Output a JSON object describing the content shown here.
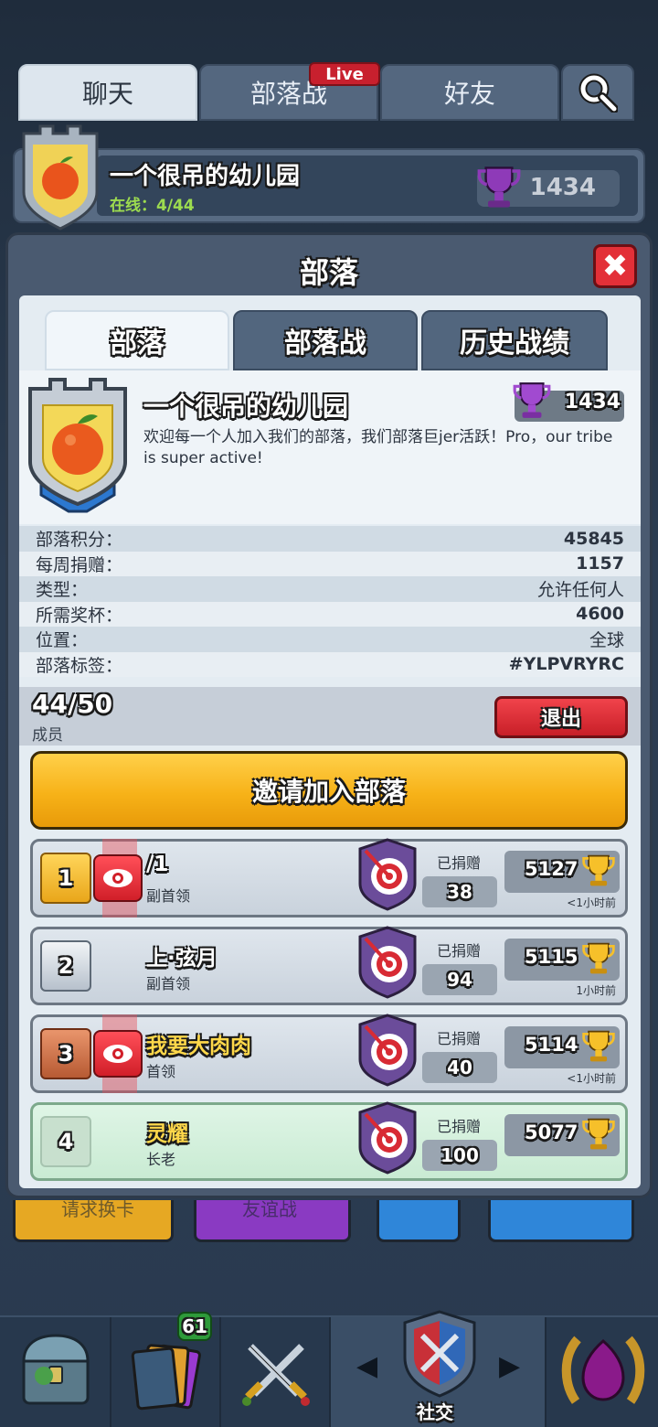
{
  "top_tabs": {
    "chat": "聊天",
    "clan_war": "部落战",
    "friends": "好友",
    "live": "Live"
  },
  "bg_clan": {
    "name": "一个很吊的幼儿园",
    "online": "在线：4/44",
    "trophies": "1434"
  },
  "modal": {
    "title": "部落",
    "close": "✖",
    "tabs": [
      "部落",
      "部落战",
      "历史战绩"
    ]
  },
  "clan": {
    "name": "一个很吊的幼儿园",
    "trophies": "1434",
    "description": "欢迎每一个人加入我们的部落，我们部落巨jer活跃！Pro，our tribe is super active!",
    "stats": [
      {
        "label": "部落积分：",
        "value": "45845"
      },
      {
        "label": "每周捐赠：",
        "value": "1157"
      },
      {
        "label": "类型：",
        "value": "允许任何人"
      },
      {
        "label": "所需奖杯：",
        "value": "4600"
      },
      {
        "label": "位置：",
        "value": "全球"
      },
      {
        "label": "部落标签：",
        "value": "#YLPVRYRC"
      }
    ]
  },
  "members_bar": {
    "count": "44/50",
    "label": "成员",
    "leave": "退出"
  },
  "invite": {
    "label": "邀请加入部落"
  },
  "members": [
    {
      "rank": "1",
      "name": "/1",
      "role": "副首领",
      "donated_label": "已捐赠",
      "donated": "38",
      "trophies": "5127",
      "last_seen": "<1小时前"
    },
    {
      "rank": "2",
      "name": "上·弦月",
      "role": "副首领",
      "donated_label": "已捐赠",
      "donated": "94",
      "trophies": "5115",
      "last_seen": "1小时前"
    },
    {
      "rank": "3",
      "name": "我要大肉肉",
      "role": "首领",
      "donated_label": "已捐赠",
      "donated": "40",
      "trophies": "5114",
      "last_seen": "<1小时前"
    },
    {
      "rank": "4",
      "name": "灵耀",
      "role": "长老",
      "donated_label": "已捐赠",
      "donated": "100",
      "trophies": "5077",
      "last_seen": ""
    }
  ],
  "bg_buttons": {
    "request": "请求换卡",
    "friendly": "友谊战"
  },
  "bottom_nav": {
    "cards_badge": "61",
    "social_label": "社交"
  }
}
